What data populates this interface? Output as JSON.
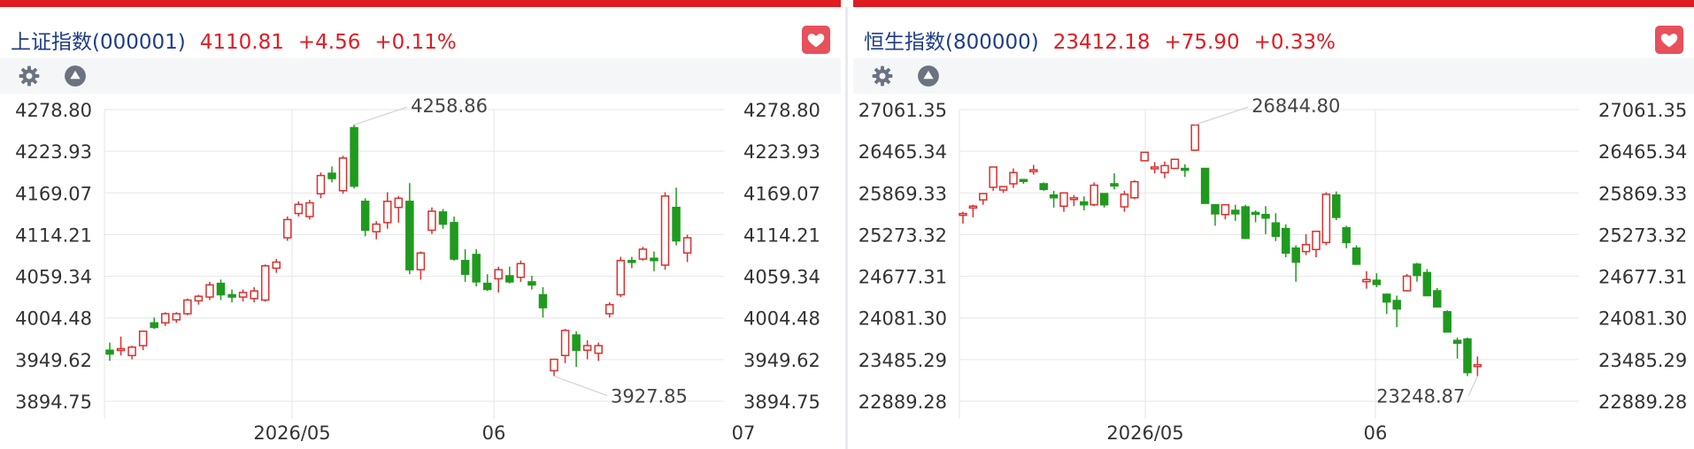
{
  "colors": {
    "up": "#d9302f",
    "down": "#1f9a1f",
    "accent": "#e11b22",
    "grid": "#e6e6e6"
  },
  "panels": [
    {
      "title": "上证指数(000001)",
      "price": "4110.81",
      "change": "+4.56",
      "change_pct": "+0.11%",
      "icons": {
        "settings": "gear-icon",
        "collapse": "triangle-up-icon",
        "favorite": "heart-icon"
      },
      "annotations": {
        "high": "4258.86",
        "low": "3927.85"
      }
    },
    {
      "title": "恒生指数(800000)",
      "price": "23412.18",
      "change": "+75.90",
      "change_pct": "+0.33%",
      "icons": {
        "settings": "gear-icon",
        "collapse": "triangle-up-icon",
        "favorite": "heart-icon"
      },
      "annotations": {
        "high": "26844.80",
        "low": "23248.87"
      }
    }
  ],
  "chart_data": [
    {
      "type": "candlestick",
      "title": "上证指数(000001)",
      "y_ticks": [
        "4278.80",
        "4223.93",
        "4169.07",
        "4114.21",
        "4059.34",
        "4004.48",
        "3949.62",
        "3894.75"
      ],
      "ylim": [
        3894.75,
        4278.8
      ],
      "x_ticks": [
        "2026/05",
        "06",
        "07"
      ],
      "grid": true,
      "annotations": [
        {
          "label": "4258.86",
          "value": 4258.86
        },
        {
          "label": "3927.85",
          "value": 3927.85
        }
      ],
      "candles": [
        {
          "o": 3962,
          "h": 3972,
          "l": 3948,
          "c": 3957
        },
        {
          "o": 3963,
          "h": 3980,
          "l": 3955,
          "c": 3964
        },
        {
          "o": 3955,
          "h": 3968,
          "l": 3950,
          "c": 3966
        },
        {
          "o": 3968,
          "h": 3988,
          "l": 3962,
          "c": 3987
        },
        {
          "o": 3998,
          "h": 4005,
          "l": 3990,
          "c": 3992
        },
        {
          "o": 3998,
          "h": 4012,
          "l": 3994,
          "c": 4010
        },
        {
          "o": 4002,
          "h": 4012,
          "l": 3998,
          "c": 4010
        },
        {
          "o": 4010,
          "h": 4030,
          "l": 4008,
          "c": 4028
        },
        {
          "o": 4027,
          "h": 4035,
          "l": 4022,
          "c": 4033
        },
        {
          "o": 4032,
          "h": 4052,
          "l": 4028,
          "c": 4048
        },
        {
          "o": 4050,
          "h": 4055,
          "l": 4028,
          "c": 4035
        },
        {
          "o": 4035,
          "h": 4042,
          "l": 4025,
          "c": 4032
        },
        {
          "o": 4032,
          "h": 4042,
          "l": 4026,
          "c": 4038
        },
        {
          "o": 4030,
          "h": 4045,
          "l": 4025,
          "c": 4040
        },
        {
          "o": 4028,
          "h": 4075,
          "l": 4026,
          "c": 4073
        },
        {
          "o": 4070,
          "h": 4082,
          "l": 4064,
          "c": 4078
        },
        {
          "o": 4110,
          "h": 4138,
          "l": 4106,
          "c": 4134
        },
        {
          "o": 4142,
          "h": 4158,
          "l": 4138,
          "c": 4154
        },
        {
          "o": 4138,
          "h": 4160,
          "l": 4134,
          "c": 4156
        },
        {
          "o": 4168,
          "h": 4196,
          "l": 4162,
          "c": 4192
        },
        {
          "o": 4195,
          "h": 4204,
          "l": 4183,
          "c": 4188
        },
        {
          "o": 4172,
          "h": 4218,
          "l": 4168,
          "c": 4215
        },
        {
          "o": 4255,
          "h": 4259,
          "l": 4175,
          "c": 4178
        },
        {
          "o": 4158,
          "h": 4162,
          "l": 4112,
          "c": 4120
        },
        {
          "o": 4118,
          "h": 4132,
          "l": 4108,
          "c": 4128
        },
        {
          "o": 4130,
          "h": 4170,
          "l": 4122,
          "c": 4158
        },
        {
          "o": 4150,
          "h": 4165,
          "l": 4130,
          "c": 4162
        },
        {
          "o": 4158,
          "h": 4182,
          "l": 4062,
          "c": 4068
        },
        {
          "o": 4068,
          "h": 4092,
          "l": 4055,
          "c": 4090
        },
        {
          "o": 4120,
          "h": 4150,
          "l": 4115,
          "c": 4145
        },
        {
          "o": 4144,
          "h": 4148,
          "l": 4122,
          "c": 4128
        },
        {
          "o": 4130,
          "h": 4138,
          "l": 4080,
          "c": 4082
        },
        {
          "o": 4080,
          "h": 4095,
          "l": 4052,
          "c": 4062
        },
        {
          "o": 4088,
          "h": 4095,
          "l": 4046,
          "c": 4052
        },
        {
          "o": 4050,
          "h": 4062,
          "l": 4040,
          "c": 4042
        },
        {
          "o": 4056,
          "h": 4072,
          "l": 4038,
          "c": 4068
        },
        {
          "o": 4060,
          "h": 4072,
          "l": 4050,
          "c": 4052
        },
        {
          "o": 4058,
          "h": 4080,
          "l": 4052,
          "c": 4076
        },
        {
          "o": 4052,
          "h": 4060,
          "l": 4042,
          "c": 4048
        },
        {
          "o": 4035,
          "h": 4045,
          "l": 4005,
          "c": 4018
        },
        {
          "o": 3935,
          "h": 3948,
          "l": 3928,
          "c": 3950
        },
        {
          "o": 3955,
          "h": 3990,
          "l": 3945,
          "c": 3988
        },
        {
          "o": 3982,
          "h": 3987,
          "l": 3940,
          "c": 3962
        },
        {
          "o": 3962,
          "h": 3975,
          "l": 3950,
          "c": 3968
        },
        {
          "o": 3958,
          "h": 3972,
          "l": 3948,
          "c": 3968
        },
        {
          "o": 4010,
          "h": 4025,
          "l": 4005,
          "c": 4022
        },
        {
          "o": 4035,
          "h": 4085,
          "l": 4032,
          "c": 4080
        },
        {
          "o": 4080,
          "h": 4085,
          "l": 4070,
          "c": 4079
        },
        {
          "o": 4082,
          "h": 4098,
          "l": 4080,
          "c": 4095
        },
        {
          "o": 4083,
          "h": 4092,
          "l": 4066,
          "c": 4080
        },
        {
          "o": 4074,
          "h": 4170,
          "l": 4068,
          "c": 4165
        },
        {
          "o": 4150,
          "h": 4176,
          "l": 4100,
          "c": 4106
        },
        {
          "o": 4090,
          "h": 4114,
          "l": 4078,
          "c": 4110
        }
      ]
    },
    {
      "type": "candlestick",
      "title": "恒生指数(800000)",
      "y_ticks": [
        "27061.35",
        "26465.34",
        "25869.33",
        "25273.32",
        "24677.31",
        "24081.30",
        "23485.29",
        "22889.28"
      ],
      "ylim": [
        22889.28,
        27061.35
      ],
      "x_ticks": [
        "2026/05",
        "06"
      ],
      "grid": true,
      "annotations": [
        {
          "label": "26844.80",
          "value": 26844.8
        },
        {
          "label": "23248.87",
          "value": 23248.87
        }
      ],
      "candles": [
        {
          "o": 25560,
          "h": 25600,
          "l": 25430,
          "c": 25575
        },
        {
          "o": 25660,
          "h": 25700,
          "l": 25520,
          "c": 25680
        },
        {
          "o": 25770,
          "h": 25840,
          "l": 25700,
          "c": 25860
        },
        {
          "o": 25950,
          "h": 26200,
          "l": 25900,
          "c": 26240
        },
        {
          "o": 25910,
          "h": 25960,
          "l": 25870,
          "c": 25960
        },
        {
          "o": 26000,
          "h": 26220,
          "l": 25940,
          "c": 26160
        },
        {
          "o": 26060,
          "h": 26070,
          "l": 26000,
          "c": 26040
        },
        {
          "o": 26180,
          "h": 26270,
          "l": 26130,
          "c": 26200
        },
        {
          "o": 26000,
          "h": 26020,
          "l": 25900,
          "c": 25920
        },
        {
          "o": 25840,
          "h": 25900,
          "l": 25660,
          "c": 25800
        },
        {
          "o": 25680,
          "h": 25860,
          "l": 25600,
          "c": 25870
        },
        {
          "o": 25790,
          "h": 25840,
          "l": 25680,
          "c": 25800
        },
        {
          "o": 25740,
          "h": 25820,
          "l": 25620,
          "c": 25700
        },
        {
          "o": 25700,
          "h": 26020,
          "l": 25680,
          "c": 25980
        },
        {
          "o": 25860,
          "h": 25860,
          "l": 25660,
          "c": 25700
        },
        {
          "o": 26000,
          "h": 26150,
          "l": 25920,
          "c": 25970
        },
        {
          "o": 25670,
          "h": 25900,
          "l": 25600,
          "c": 25850
        },
        {
          "o": 25800,
          "h": 26050,
          "l": 25780,
          "c": 26030
        },
        {
          "o": 26330,
          "h": 26440,
          "l": 26320,
          "c": 26450
        },
        {
          "o": 26230,
          "h": 26310,
          "l": 26150,
          "c": 26240
        },
        {
          "o": 26160,
          "h": 26320,
          "l": 26080,
          "c": 26260
        },
        {
          "o": 26220,
          "h": 26340,
          "l": 26210,
          "c": 26350
        },
        {
          "o": 26220,
          "h": 26280,
          "l": 26100,
          "c": 26200
        },
        {
          "o": 26480,
          "h": 26845,
          "l": 26470,
          "c": 26840
        },
        {
          "o": 26220,
          "h": 26220,
          "l": 25780,
          "c": 25720
        },
        {
          "o": 25700,
          "h": 25710,
          "l": 25400,
          "c": 25570
        },
        {
          "o": 25560,
          "h": 25600,
          "l": 25490,
          "c": 25700
        },
        {
          "o": 25620,
          "h": 25700,
          "l": 25470,
          "c": 25570
        },
        {
          "o": 25670,
          "h": 25700,
          "l": 25210,
          "c": 25220
        },
        {
          "o": 25590,
          "h": 25620,
          "l": 25450,
          "c": 25580
        },
        {
          "o": 25560,
          "h": 25680,
          "l": 25280,
          "c": 25510
        },
        {
          "o": 25440,
          "h": 25580,
          "l": 25180,
          "c": 25250
        },
        {
          "o": 25360,
          "h": 25420,
          "l": 24950,
          "c": 25010
        },
        {
          "o": 25080,
          "h": 25120,
          "l": 24600,
          "c": 24880
        },
        {
          "o": 25030,
          "h": 25280,
          "l": 24980,
          "c": 25130
        },
        {
          "o": 25060,
          "h": 25320,
          "l": 24950,
          "c": 25320
        },
        {
          "o": 25160,
          "h": 25880,
          "l": 25120,
          "c": 25850
        },
        {
          "o": 25840,
          "h": 25890,
          "l": 25480,
          "c": 25520
        },
        {
          "o": 25370,
          "h": 25400,
          "l": 25080,
          "c": 25160
        },
        {
          "o": 25080,
          "h": 25120,
          "l": 24840,
          "c": 24850
        },
        {
          "o": 24600,
          "h": 24750,
          "l": 24500,
          "c": 24630
        },
        {
          "o": 24620,
          "h": 24720,
          "l": 24520,
          "c": 24560
        },
        {
          "o": 24420,
          "h": 24430,
          "l": 24140,
          "c": 24310
        },
        {
          "o": 24330,
          "h": 24400,
          "l": 23950,
          "c": 24210
        },
        {
          "o": 24470,
          "h": 24710,
          "l": 24460,
          "c": 24680
        },
        {
          "o": 24850,
          "h": 24870,
          "l": 24600,
          "c": 24690
        },
        {
          "o": 24730,
          "h": 24780,
          "l": 24400,
          "c": 24400
        },
        {
          "o": 24470,
          "h": 24510,
          "l": 24300,
          "c": 24240
        },
        {
          "o": 24170,
          "h": 24190,
          "l": 23960,
          "c": 23880
        },
        {
          "o": 23760,
          "h": 23800,
          "l": 23500,
          "c": 23720
        },
        {
          "o": 23780,
          "h": 23800,
          "l": 23250,
          "c": 23300
        },
        {
          "o": 23400,
          "h": 23530,
          "l": 23249,
          "c": 23412
        }
      ]
    }
  ]
}
